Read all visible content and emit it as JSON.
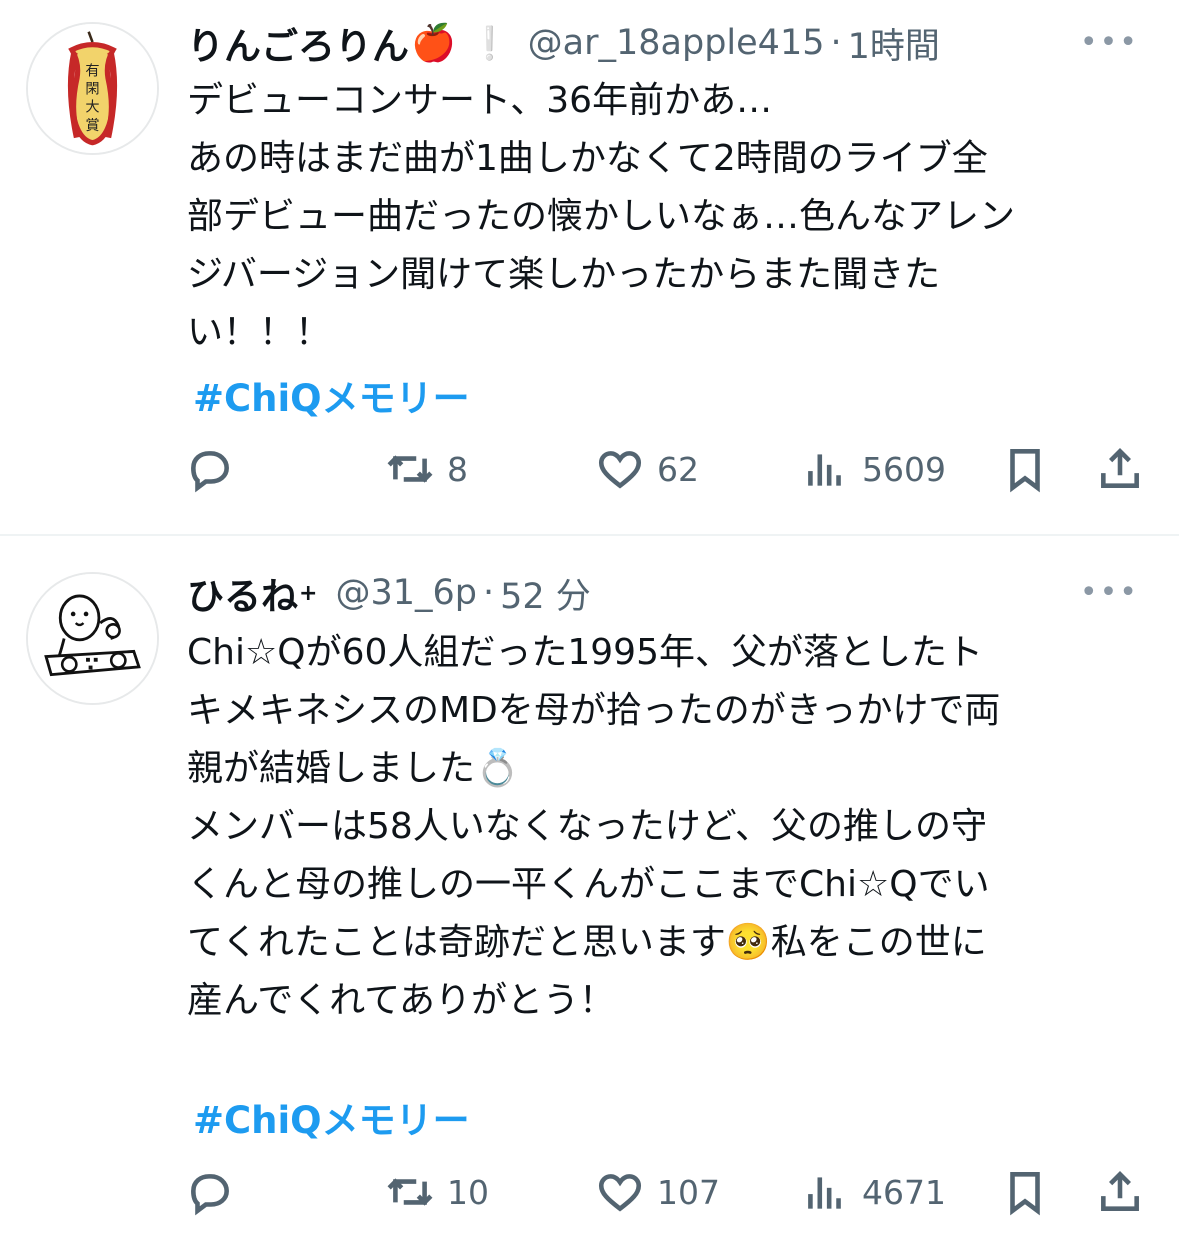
{
  "tweets": [
    {
      "display_name": "りんごろりん",
      "name_emoji": "🍎",
      "badge_glyph": "❕",
      "handle": "@ar_18apple415",
      "separator": "·",
      "time": "1時間",
      "text": "デビューコンサート、36年前かあ…\nあの時はまだ曲が1曲しかなくて2時間のライブ全\n部デビュー曲だったの懐かしいなぁ…色んなアレン\nジバージョン聞けて楽しかったからまた聞きた\nい！！！",
      "hashtag": "#ChiQメモリー",
      "retweets": "8",
      "likes": "62",
      "views": "5609",
      "avatar_text": "有閑大賞"
    },
    {
      "display_name": "ひるね",
      "name_suffix": "+",
      "handle": "@31_6p",
      "separator": "·",
      "time": "52 分",
      "text": "Chi☆Qが60人組だった1995年、父が落としたト\nキメキネシスのMDを母が拾ったのがきっかけで両\n親が結婚しました💍\nメンバーは58人いなくなったけど、父の推しの守\nくんと母の推しの一平くんがここまでChi☆Qでい\nてくれたことは奇跡だと思います🥺私をこの世に\n産んでくれてありがとう！",
      "hashtag": "#ChiQメモリー",
      "retweets": "10",
      "likes": "107",
      "views": "4671"
    }
  ],
  "ui": {
    "more_glyph": "•••"
  },
  "colors": {
    "text": "#0f1419",
    "secondary": "#536471",
    "link": "#1d9bf0",
    "divider": "#eff3f4"
  },
  "icons": [
    "reply-icon",
    "retweet-icon",
    "like-icon",
    "views-icon",
    "bookmark-icon",
    "share-icon",
    "more-icon"
  ]
}
